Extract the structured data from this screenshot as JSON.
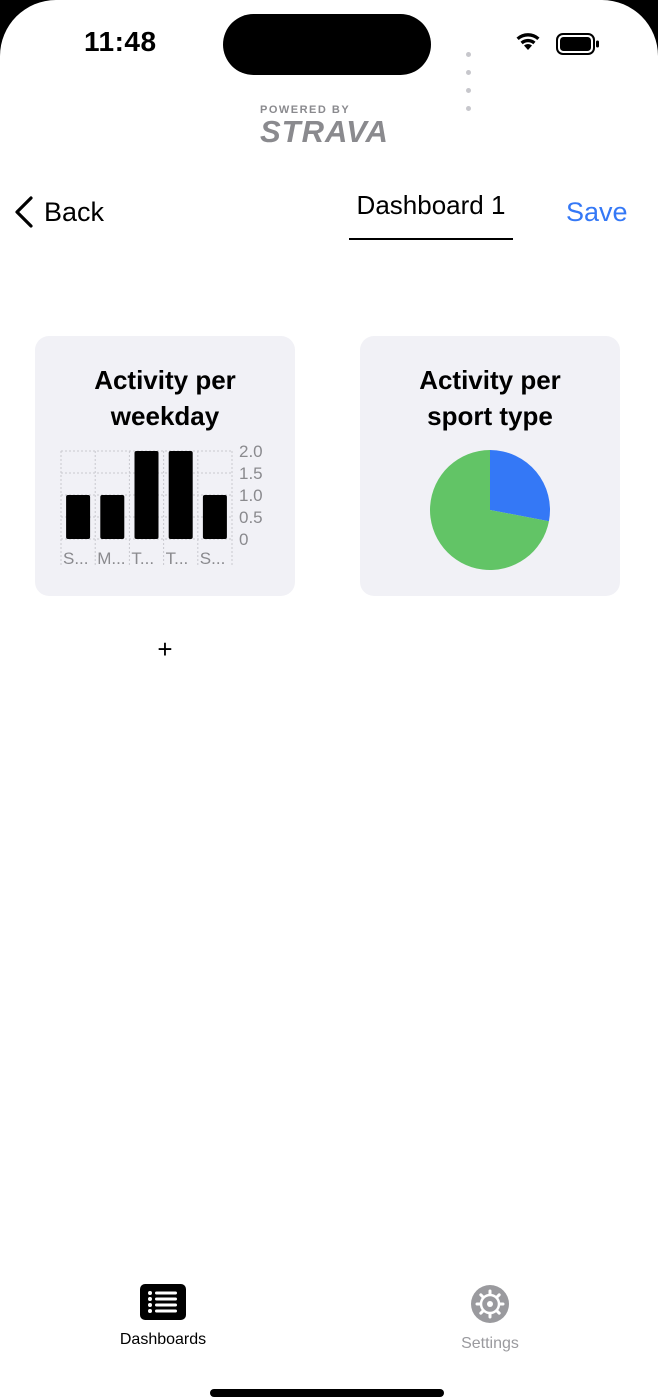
{
  "status_bar": {
    "time": "11:48"
  },
  "branding": {
    "powered_by": "POWERED BY",
    "name": "STRAVA"
  },
  "nav": {
    "back_label": "Back",
    "title_value": "Dashboard 1",
    "save_label": "Save"
  },
  "cards": [
    {
      "title_line1": "Activity per",
      "title_line2": "weekday"
    },
    {
      "title_line1": "Activity per",
      "title_line2": "sport type"
    }
  ],
  "add_label": "+",
  "tabs": [
    {
      "label": "Dashboards",
      "icon": "list-icon",
      "selected": true
    },
    {
      "label": "Settings",
      "icon": "gear-icon",
      "selected": false
    }
  ],
  "colors": {
    "accent": "#3478f6",
    "card_bg": "#f1f1f6",
    "pie_blue": "#3478f6",
    "pie_green": "#62c466"
  },
  "chart_data": [
    {
      "type": "bar",
      "categories": [
        "S...",
        "M...",
        "T...",
        "T...",
        "S..."
      ],
      "values": [
        1,
        1,
        2,
        2,
        1
      ],
      "ytick_labels": [
        "0",
        "0.5",
        "1.0",
        "1.5",
        "2.0"
      ],
      "ylim": [
        0,
        2
      ],
      "grid": true,
      "xlabel": "",
      "ylabel": ""
    },
    {
      "type": "pie",
      "slices": [
        {
          "value": 0.28,
          "color": "#3478f6"
        },
        {
          "value": 0.72,
          "color": "#62c466"
        }
      ]
    }
  ]
}
